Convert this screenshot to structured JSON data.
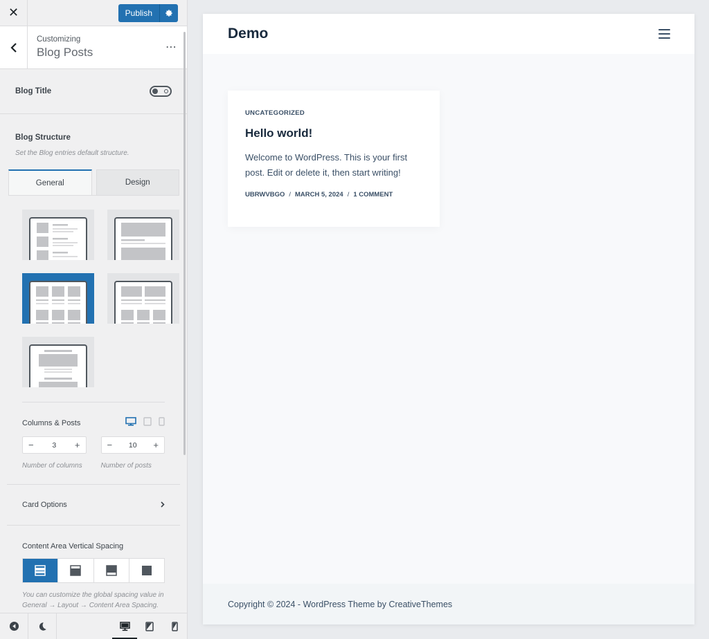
{
  "topbar": {
    "close_label": "✕",
    "publish_label": "Publish"
  },
  "header": {
    "subtitle": "Customizing",
    "title": "Blog Posts",
    "more_label": "⋯"
  },
  "blog_title": {
    "label": "Blog Title",
    "enabled": false
  },
  "structure": {
    "label": "Blog Structure",
    "description": "Set the Blog entries default structure.",
    "tabs": [
      {
        "label": "General",
        "active": true
      },
      {
        "label": "Design",
        "active": false
      }
    ],
    "layouts": [
      {
        "name": "simple",
        "selected": false
      },
      {
        "name": "classic",
        "selected": false
      },
      {
        "name": "grid",
        "selected": true
      },
      {
        "name": "enhanced-grid",
        "selected": false
      },
      {
        "name": "gutenberg",
        "selected": false
      }
    ]
  },
  "columns_posts": {
    "label": "Columns & Posts",
    "columns_value": "3",
    "posts_value": "10",
    "columns_note": "Number of columns",
    "posts_note": "Number of posts",
    "minus_label": "−",
    "plus_label": "+"
  },
  "card_options": {
    "label": "Card Options"
  },
  "spacing": {
    "label": "Content Area Vertical Spacing",
    "note": "You can customize the global spacing value in General → Layout → Content Area Spacing."
  },
  "preview": {
    "site_title": "Demo",
    "post": {
      "category": "UNCATEGORIZED",
      "title": "Hello world!",
      "excerpt": "Welcome to WordPress. This is your first post. Edit or delete it, then start writing!",
      "author": "UBRWVBGO",
      "date": "MARCH 5, 2024",
      "comments": "1 COMMENT",
      "sep": "/"
    },
    "footer": "Copyright © 2024 - WordPress Theme by CreativeThemes"
  },
  "colors": {
    "accent": "#2271b1",
    "icon": "#50575e",
    "heading": "#192a3d",
    "text": "#3a4f66"
  }
}
